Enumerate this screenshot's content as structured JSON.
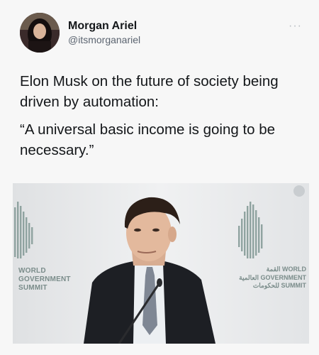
{
  "author": {
    "display_name": "Morgan Ariel",
    "handle": "@itsmorganariel"
  },
  "menu": {
    "icon": "more-dots-icon",
    "glyph": "···"
  },
  "tweet": {
    "paragraphs": [
      "Elon Musk on the future of society being driven by automation:",
      "“A universal basic income is going to be necessary.”"
    ]
  },
  "media": {
    "logo_left": {
      "line1": "WORLD",
      "line2": "GOVERNMENT",
      "line3": "SUMMIT"
    },
    "logo_right": {
      "line1": "القمة WORLD",
      "line2": "العالمية GOVERNMENT",
      "line3": "للحكومات SUMMIT"
    },
    "colors": {
      "background": "#e9eaec",
      "logo": "#7a8c8a",
      "suit": "#1d1f24",
      "shirt": "#eceff2"
    }
  }
}
